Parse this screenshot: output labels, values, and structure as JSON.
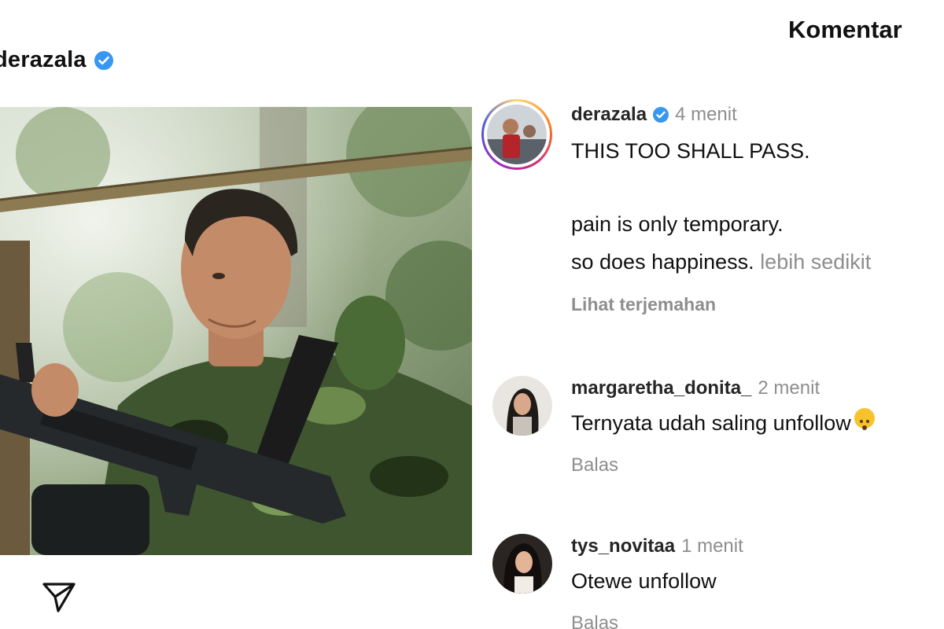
{
  "post": {
    "username": "derazala"
  },
  "comments_panel": {
    "title": "Komentar"
  },
  "caption": {
    "username": "derazala",
    "time": "4 menit",
    "lines": [
      "THIS TOO SHALL PASS.",
      "pain is only temporary.",
      "so does happiness."
    ],
    "more_label": "lebih sedikit",
    "translate_label": "Lihat terjemahan"
  },
  "comments": [
    {
      "username": "margaretha_donita_",
      "time": "2 menit",
      "text": "Ternyata udah saling unfollow",
      "reply_label": "Balas"
    },
    {
      "username": "tys_novitaa",
      "time": "1 menit",
      "text": "Otewe unfollow",
      "reply_label": "Balas"
    }
  ],
  "icons": {
    "verified": "verified-badge-icon",
    "comment": "comment-icon",
    "share": "paper-plane-icon",
    "emoji": "emoji-icon"
  },
  "colors": {
    "verified": "#3897f0",
    "text": "#111111",
    "muted": "#8e8e8e"
  }
}
